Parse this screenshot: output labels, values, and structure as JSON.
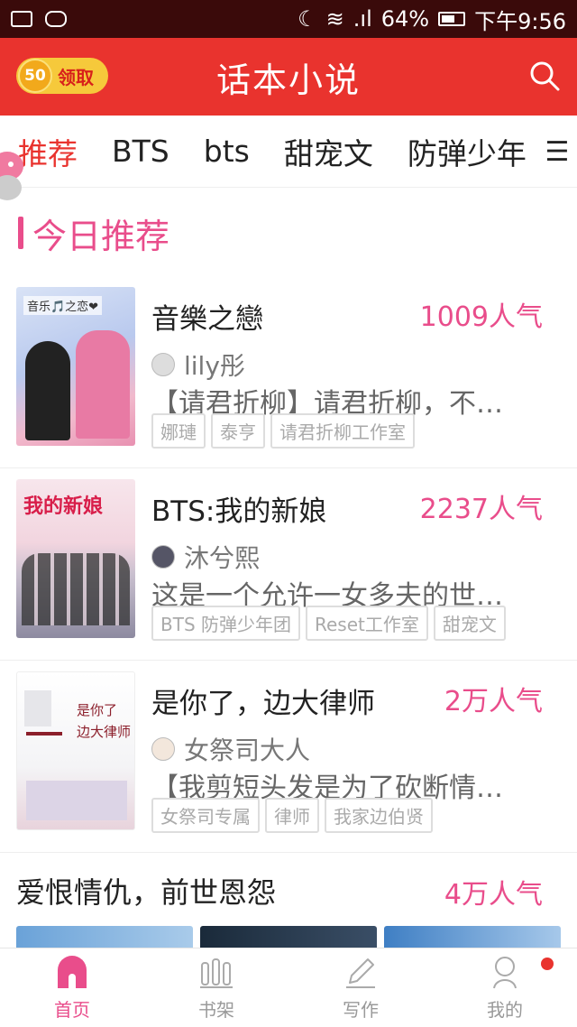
{
  "status_bar": {
    "battery": "64%",
    "time": "下午9:56"
  },
  "header": {
    "coin_value": "50",
    "coin_action": "领取",
    "title": "话本小说"
  },
  "tabs": [
    {
      "label": "推荐"
    },
    {
      "label": "BTS"
    },
    {
      "label": "bts"
    },
    {
      "label": "甜宠文"
    },
    {
      "label": "防弹少年"
    }
  ],
  "section": {
    "title": "今日推荐"
  },
  "books": [
    {
      "title": "音樂之戀",
      "popularity": "1009人气",
      "author": "lily彤",
      "description": "【请君折柳】请君折柳，不…",
      "tags": [
        "娜璉",
        "泰亨",
        "请君折柳工作室"
      ],
      "cover_text": "音乐🎵之恋❤"
    },
    {
      "title": "BTS:我的新娘",
      "popularity": "2237人气",
      "author": "沐兮熙",
      "description": "这是一个允许一女多夫的世…",
      "tags": [
        "BTS 防弹少年团",
        "Reset工作室",
        "甜宠文"
      ],
      "cover_text": "我的新娘"
    },
    {
      "title": "是你了，边大律师",
      "popularity": "2万人气",
      "author": "女祭司大人",
      "description": "【我剪短头发是为了砍断情…",
      "tags": [
        "女祭司专属",
        "律师",
        "我家边伯贤"
      ],
      "cover_text": "是你了 边大律师"
    }
  ],
  "section2": {
    "title": "爱恨情仇，前世恩怨",
    "popularity": "4万人气"
  },
  "bottom_nav": [
    {
      "label": "首页",
      "icon": "home-icon"
    },
    {
      "label": "书架",
      "icon": "bookshelf-icon"
    },
    {
      "label": "写作",
      "icon": "pencil-icon"
    },
    {
      "label": "我的",
      "icon": "profile-icon"
    }
  ],
  "colors": {
    "brand_red": "#e9332e",
    "accent_pink": "#e94d8b"
  }
}
